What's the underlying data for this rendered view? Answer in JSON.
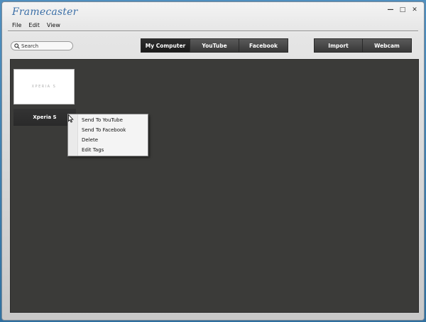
{
  "app": {
    "title": "Framecaster"
  },
  "window_controls": {
    "minimize": "—",
    "maximize": "□",
    "close": "✕"
  },
  "menu": [
    "File",
    "Edit",
    "View"
  ],
  "search": {
    "placeholder": "Search"
  },
  "source_tabs": [
    {
      "label": "My Computer",
      "active": true
    },
    {
      "label": "YouTube",
      "active": false
    },
    {
      "label": "Facebook",
      "active": false
    }
  ],
  "capture_tabs": [
    {
      "label": "Import"
    },
    {
      "label": "Webcam"
    }
  ],
  "videos": [
    {
      "title": "Xperia S",
      "thumbnail_text": "XPERIA S"
    }
  ],
  "context_menu": [
    "Send To YouTube",
    "Send To Facebook",
    "Delete",
    "Edit Tags"
  ],
  "colors": {
    "content_bg": "#3b3b39",
    "tab_bg": "#383838",
    "logo": "#3b6fa7"
  }
}
